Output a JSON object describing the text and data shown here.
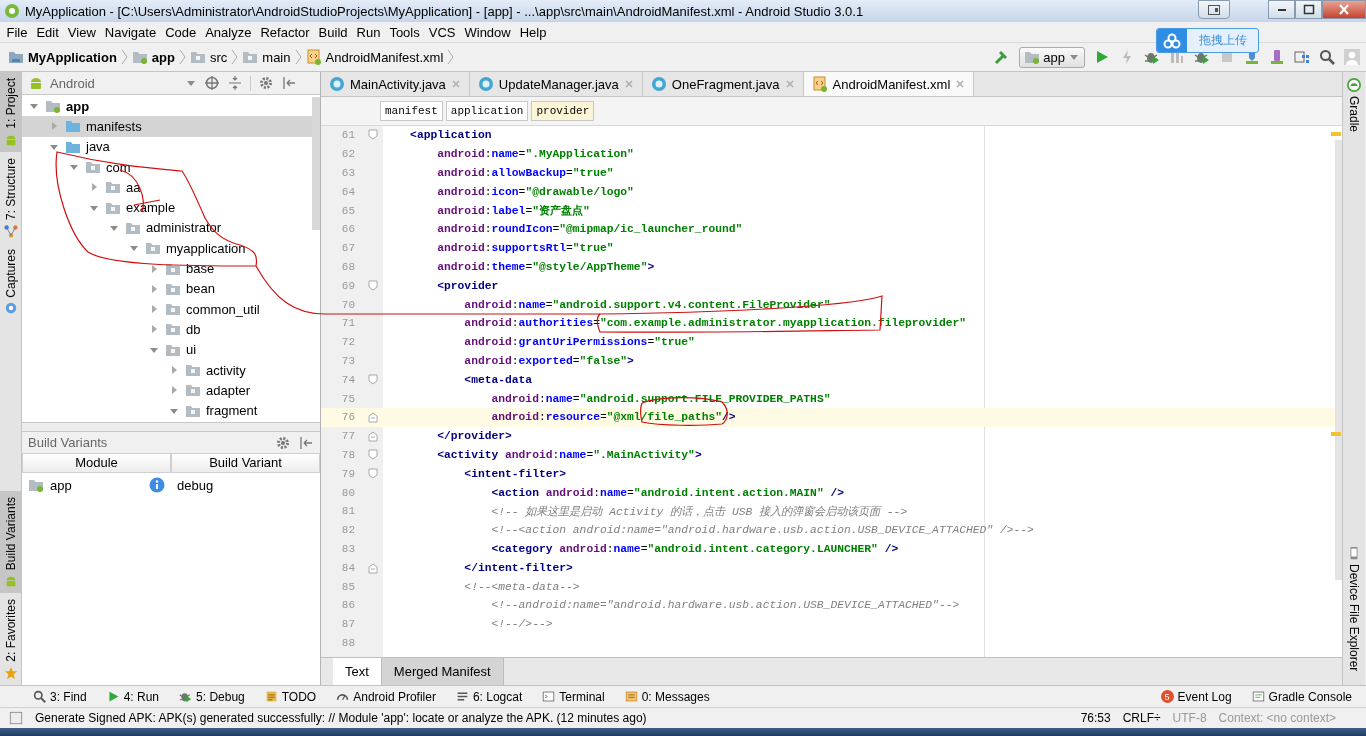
{
  "window": {
    "title": "MyApplication - [C:\\Users\\Administrator\\AndroidStudioProjects\\MyApplication] - [app] - ...\\app\\src\\main\\AndroidManifest.xml - Android Studio 3.0.1"
  },
  "menu": [
    "File",
    "Edit",
    "View",
    "Navigate",
    "Code",
    "Analyze",
    "Refactor",
    "Build",
    "Run",
    "Tools",
    "VCS",
    "Window",
    "Help"
  ],
  "breadcrumbs": [
    {
      "label": "MyApplication",
      "kind": "project"
    },
    {
      "label": "app",
      "kind": "module"
    },
    {
      "label": "src",
      "kind": "folder"
    },
    {
      "label": "main",
      "kind": "folder"
    },
    {
      "label": "AndroidManifest.xml",
      "kind": "manifest"
    }
  ],
  "run_config": "app",
  "upload_widget": {
    "label": "拖拽上传"
  },
  "left_stripe": [
    {
      "label": "1: Project",
      "kind": "project",
      "selected": true
    },
    {
      "label": "7: Structure",
      "kind": "structure",
      "selected": false
    },
    {
      "label": "Captures",
      "kind": "captures",
      "selected": false
    }
  ],
  "left_stripe_bottom": [
    {
      "label": "Build Variants",
      "kind": "variants",
      "selected": true
    },
    {
      "label": "2: Favorites",
      "kind": "favorites",
      "selected": false
    }
  ],
  "project_panel": {
    "view": "Android",
    "tree": [
      {
        "label": "app",
        "kind": "module",
        "expanded": true,
        "selected": false,
        "children": [
          {
            "label": "manifests",
            "kind": "folder",
            "expanded": false,
            "selected": true
          },
          {
            "label": "java",
            "kind": "folder",
            "expanded": true,
            "selected": false,
            "children": [
              {
                "label": "com",
                "kind": "package",
                "expanded": true,
                "selected": false,
                "children": [
                  {
                    "label": "aa",
                    "kind": "package",
                    "expanded": false,
                    "selected": false
                  },
                  {
                    "label": "example",
                    "kind": "package",
                    "expanded": true,
                    "selected": false,
                    "children": [
                      {
                        "label": "administrator",
                        "kind": "package",
                        "expanded": true,
                        "selected": false,
                        "children": [
                          {
                            "label": "myapplication",
                            "kind": "package",
                            "expanded": true,
                            "selected": false,
                            "children": [
                              {
                                "label": "base",
                                "kind": "package",
                                "expanded": false,
                                "selected": false
                              },
                              {
                                "label": "bean",
                                "kind": "package",
                                "expanded": false,
                                "selected": false
                              },
                              {
                                "label": "common_util",
                                "kind": "package",
                                "expanded": false,
                                "selected": false
                              },
                              {
                                "label": "db",
                                "kind": "package",
                                "expanded": false,
                                "selected": false
                              },
                              {
                                "label": "ui",
                                "kind": "package",
                                "expanded": true,
                                "selected": false,
                                "children": [
                                  {
                                    "label": "activity",
                                    "kind": "package",
                                    "expanded": false,
                                    "selected": false
                                  },
                                  {
                                    "label": "adapter",
                                    "kind": "package",
                                    "expanded": false,
                                    "selected": false
                                  },
                                  {
                                    "label": "fragment",
                                    "kind": "package",
                                    "expanded": true,
                                    "selected": false
                                  }
                                ]
                              }
                            ]
                          }
                        ]
                      }
                    ]
                  }
                ]
              }
            ]
          }
        ]
      }
    ]
  },
  "build_variants": {
    "title": "Build Variants",
    "columns": [
      "Module",
      "Build Variant"
    ],
    "rows": [
      {
        "module": "app",
        "variant": "debug"
      }
    ]
  },
  "editor_tabs": [
    {
      "label": "MainActivity.java",
      "kind": "class",
      "selected": false
    },
    {
      "label": "UpdateManager.java",
      "kind": "class",
      "selected": false
    },
    {
      "label": "OneFragment.java",
      "kind": "class",
      "selected": false
    },
    {
      "label": "AndroidManifest.xml",
      "kind": "manifest",
      "selected": true
    }
  ],
  "tag_path": [
    {
      "label": "manifest",
      "selected": false
    },
    {
      "label": "application",
      "selected": false
    },
    {
      "label": "provider",
      "selected": true
    }
  ],
  "code_lines": [
    {
      "number": "61",
      "kind": "fold-start",
      "current": false,
      "tokens": [
        {
          "kind": "tag",
          "text": "    <application"
        }
      ]
    },
    {
      "number": "62",
      "kind": "plain",
      "current": false,
      "tokens": [
        {
          "kind": "ns",
          "text": "        android"
        },
        {
          "kind": "punct",
          "text": ":"
        },
        {
          "kind": "attr",
          "text": "name"
        },
        {
          "kind": "punct",
          "text": "="
        },
        {
          "kind": "value",
          "text": "\".MyApplication\""
        }
      ]
    },
    {
      "number": "63",
      "kind": "plain",
      "current": false,
      "tokens": [
        {
          "kind": "ns",
          "text": "        android"
        },
        {
          "kind": "punct",
          "text": ":"
        },
        {
          "kind": "attr",
          "text": "allowBackup"
        },
        {
          "kind": "punct",
          "text": "="
        },
        {
          "kind": "value",
          "text": "\"true\""
        }
      ]
    },
    {
      "number": "64",
      "kind": "plain",
      "current": false,
      "tokens": [
        {
          "kind": "ns",
          "text": "        android"
        },
        {
          "kind": "punct",
          "text": ":"
        },
        {
          "kind": "attr",
          "text": "icon"
        },
        {
          "kind": "punct",
          "text": "="
        },
        {
          "kind": "value",
          "text": "\"@drawable/logo\""
        }
      ]
    },
    {
      "number": "65",
      "kind": "plain",
      "current": false,
      "tokens": [
        {
          "kind": "ns",
          "text": "        android"
        },
        {
          "kind": "punct",
          "text": ":"
        },
        {
          "kind": "attr",
          "text": "label"
        },
        {
          "kind": "punct",
          "text": "="
        },
        {
          "kind": "value",
          "text": "\"资产盘点\""
        }
      ]
    },
    {
      "number": "66",
      "kind": "plain",
      "current": false,
      "tokens": [
        {
          "kind": "ns",
          "text": "        android"
        },
        {
          "kind": "punct",
          "text": ":"
        },
        {
          "kind": "attr",
          "text": "roundIcon"
        },
        {
          "kind": "punct",
          "text": "="
        },
        {
          "kind": "value",
          "text": "\"@mipmap/ic_launcher_round\""
        }
      ]
    },
    {
      "number": "67",
      "kind": "plain",
      "current": false,
      "tokens": [
        {
          "kind": "ns",
          "text": "        android"
        },
        {
          "kind": "punct",
          "text": ":"
        },
        {
          "kind": "attr",
          "text": "supportsRtl"
        },
        {
          "kind": "punct",
          "text": "="
        },
        {
          "kind": "value",
          "text": "\"true\""
        }
      ]
    },
    {
      "number": "68",
      "kind": "plain",
      "current": false,
      "tokens": [
        {
          "kind": "ns",
          "text": "        android"
        },
        {
          "kind": "punct",
          "text": ":"
        },
        {
          "kind": "attr",
          "text": "theme"
        },
        {
          "kind": "punct",
          "text": "="
        },
        {
          "kind": "value",
          "text": "\"@style/AppTheme\""
        },
        {
          "kind": "tag",
          "text": ">"
        }
      ]
    },
    {
      "number": "69",
      "kind": "fold-start",
      "current": false,
      "tokens": [
        {
          "kind": "tag",
          "text": "        <provider"
        }
      ]
    },
    {
      "number": "70",
      "kind": "plain",
      "current": false,
      "tokens": [
        {
          "kind": "ns",
          "text": "            android"
        },
        {
          "kind": "punct",
          "text": ":"
        },
        {
          "kind": "attr",
          "text": "name"
        },
        {
          "kind": "punct",
          "text": "="
        },
        {
          "kind": "value",
          "text": "\"android.support.v4.content.FileProvider\""
        }
      ]
    },
    {
      "number": "71",
      "kind": "plain",
      "current": false,
      "tokens": [
        {
          "kind": "ns",
          "text": "            android"
        },
        {
          "kind": "punct",
          "text": ":"
        },
        {
          "kind": "attr",
          "text": "authorities"
        },
        {
          "kind": "punct",
          "text": "="
        },
        {
          "kind": "value",
          "text": "\"com.example.administrator.myapplication.fileprovider\""
        }
      ]
    },
    {
      "number": "72",
      "kind": "plain",
      "current": false,
      "tokens": [
        {
          "kind": "ns",
          "text": "            android"
        },
        {
          "kind": "punct",
          "text": ":"
        },
        {
          "kind": "attr",
          "text": "grantUriPermissions"
        },
        {
          "kind": "punct",
          "text": "="
        },
        {
          "kind": "value",
          "text": "\"true\""
        }
      ]
    },
    {
      "number": "73",
      "kind": "plain",
      "current": false,
      "tokens": [
        {
          "kind": "ns",
          "text": "            android"
        },
        {
          "kind": "punct",
          "text": ":"
        },
        {
          "kind": "attr",
          "text": "exported"
        },
        {
          "kind": "punct",
          "text": "="
        },
        {
          "kind": "value",
          "text": "\"false\""
        },
        {
          "kind": "tag",
          "text": ">"
        }
      ]
    },
    {
      "number": "74",
      "kind": "fold-start",
      "current": false,
      "tokens": [
        {
          "kind": "tag",
          "text": "            <meta-data"
        }
      ]
    },
    {
      "number": "75",
      "kind": "plain",
      "current": false,
      "tokens": [
        {
          "kind": "ns",
          "text": "                android"
        },
        {
          "kind": "punct",
          "text": ":"
        },
        {
          "kind": "attr",
          "text": "name"
        },
        {
          "kind": "punct",
          "text": "="
        },
        {
          "kind": "value",
          "text": "\"android.support.FILE_PROVIDER_PATHS\""
        }
      ]
    },
    {
      "number": "76",
      "kind": "fold-end",
      "current": true,
      "tokens": [
        {
          "kind": "ns",
          "text": "                android"
        },
        {
          "kind": "punct",
          "text": ":"
        },
        {
          "kind": "attr",
          "text": "resource"
        },
        {
          "kind": "punct",
          "text": "="
        },
        {
          "kind": "value",
          "text": "\"@xml/file_paths\""
        },
        {
          "kind": "tag",
          "text": "/>"
        }
      ]
    },
    {
      "number": "77",
      "kind": "fold-end",
      "current": false,
      "tokens": [
        {
          "kind": "tag",
          "text": "        </provider>"
        }
      ]
    },
    {
      "number": "78",
      "kind": "fold-start",
      "current": false,
      "tokens": [
        {
          "kind": "tag",
          "text": "        <activity"
        },
        {
          "kind": "ns",
          "text": " android"
        },
        {
          "kind": "punct",
          "text": ":"
        },
        {
          "kind": "attr",
          "text": "name"
        },
        {
          "kind": "punct",
          "text": "="
        },
        {
          "kind": "value",
          "text": "\".MainActivity\""
        },
        {
          "kind": "tag",
          "text": ">"
        }
      ]
    },
    {
      "number": "79",
      "kind": "fold-start",
      "current": false,
      "tokens": [
        {
          "kind": "tag",
          "text": "            <intent-filter>"
        }
      ]
    },
    {
      "number": "80",
      "kind": "plain",
      "current": false,
      "tokens": [
        {
          "kind": "tag",
          "text": "                <action"
        },
        {
          "kind": "ns",
          "text": " android"
        },
        {
          "kind": "punct",
          "text": ":"
        },
        {
          "kind": "attr",
          "text": "name"
        },
        {
          "kind": "punct",
          "text": "="
        },
        {
          "kind": "value",
          "text": "\"android.intent.action.MAIN\""
        },
        {
          "kind": "tag",
          "text": " />"
        }
      ]
    },
    {
      "number": "81",
      "kind": "plain",
      "current": false,
      "tokens": [
        {
          "kind": "comment",
          "text": "                <!-- 如果这里是启动 Activity 的话，点击 USB 接入的弹窗会启动该页面 -->"
        }
      ]
    },
    {
      "number": "82",
      "kind": "plain",
      "current": false,
      "tokens": [
        {
          "kind": "comment",
          "text": "                <!--<action android:name=\"android.hardware.usb.action.USB_DEVICE_ATTACHED\" />-->"
        }
      ]
    },
    {
      "number": "83",
      "kind": "plain",
      "current": false,
      "tokens": [
        {
          "kind": "tag",
          "text": "                <category"
        },
        {
          "kind": "ns",
          "text": " android"
        },
        {
          "kind": "punct",
          "text": ":"
        },
        {
          "kind": "attr",
          "text": "name"
        },
        {
          "kind": "punct",
          "text": "="
        },
        {
          "kind": "value",
          "text": "\"android.intent.category.LAUNCHER\""
        },
        {
          "kind": "tag",
          "text": " />"
        }
      ]
    },
    {
      "number": "84",
      "kind": "fold-end",
      "current": false,
      "tokens": [
        {
          "kind": "tag",
          "text": "            </intent-filter>"
        }
      ]
    },
    {
      "number": "85",
      "kind": "plain",
      "current": false,
      "tokens": [
        {
          "kind": "comment",
          "text": "            <!--<meta-data-->"
        }
      ]
    },
    {
      "number": "86",
      "kind": "plain",
      "current": false,
      "tokens": [
        {
          "kind": "comment",
          "text": "                <!--android:name=\"android.hardware.usb.action.USB_DEVICE_ATTACHED\"-->"
        }
      ]
    },
    {
      "number": "87",
      "kind": "plain",
      "current": false,
      "tokens": [
        {
          "kind": "comment",
          "text": "                <!--/>-->"
        }
      ]
    },
    {
      "number": "88",
      "kind": "plain",
      "current": false
    }
  ],
  "editor_bottom_tabs": [
    {
      "label": "Text",
      "selected": true
    },
    {
      "label": "Merged Manifest",
      "selected": false
    }
  ],
  "right_stripe": [
    {
      "label": "Gradle",
      "kind": "gradle"
    },
    {
      "label": "Device File Explorer",
      "kind": "device"
    }
  ],
  "tool_windows": [
    {
      "label": "3: Find",
      "kind": "find"
    },
    {
      "label": "4: Run",
      "kind": "run"
    },
    {
      "label": "5: Debug",
      "kind": "debug"
    },
    {
      "label": "TODO",
      "kind": "todo"
    },
    {
      "label": "Android Profiler",
      "kind": "profiler"
    },
    {
      "label": "6: Logcat",
      "kind": "logcat"
    },
    {
      "label": "Terminal",
      "kind": "terminal"
    },
    {
      "label": "0: Messages",
      "kind": "messages"
    }
  ],
  "tool_windows_right": [
    {
      "label": "Event Log",
      "kind": "eventlog",
      "badge": "5"
    },
    {
      "label": "Gradle Console",
      "kind": "console"
    }
  ],
  "status_bar": {
    "message": "Generate Signed APK: APK(s) generated successfully: // Module 'app': locate or analyze the APK. (12 minutes ago)",
    "position": "76:53",
    "line_separator": "CRLF÷",
    "encoding": "UTF-8",
    "context": "Context: <no context>"
  }
}
